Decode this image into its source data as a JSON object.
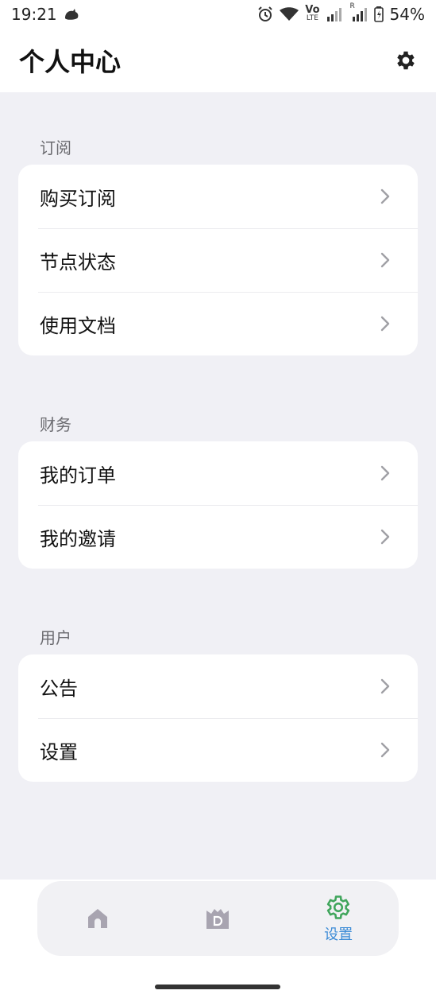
{
  "status_bar": {
    "time": "19:21",
    "battery": "54%",
    "network_label_top": "Vo",
    "network_label_bottom": "LTE",
    "roaming_label": "R",
    "icons": [
      "cat-icon",
      "alarm-icon",
      "wifi-icon",
      "signal-icon",
      "battery-icon"
    ]
  },
  "header": {
    "title": "个人中心",
    "settings_icon": "gear-icon"
  },
  "sections": [
    {
      "label": "订阅",
      "items": [
        {
          "label": "购买订阅"
        },
        {
          "label": "节点状态"
        },
        {
          "label": "使用文档"
        }
      ]
    },
    {
      "label": "财务",
      "items": [
        {
          "label": "我的订单"
        },
        {
          "label": "我的邀请"
        }
      ]
    },
    {
      "label": "用户",
      "items": [
        {
          "label": "公告"
        },
        {
          "label": "设置"
        }
      ]
    }
  ],
  "tabbar": {
    "tabs": [
      {
        "icon": "home-icon",
        "label": ""
      },
      {
        "icon": "dashboard-icon",
        "label": ""
      },
      {
        "icon": "gear-icon",
        "label": "设置",
        "active": true
      }
    ],
    "active_color": "#3a8ad6",
    "active_icon_color": "#3fa55b",
    "inactive_color": "#a8a4b0"
  }
}
